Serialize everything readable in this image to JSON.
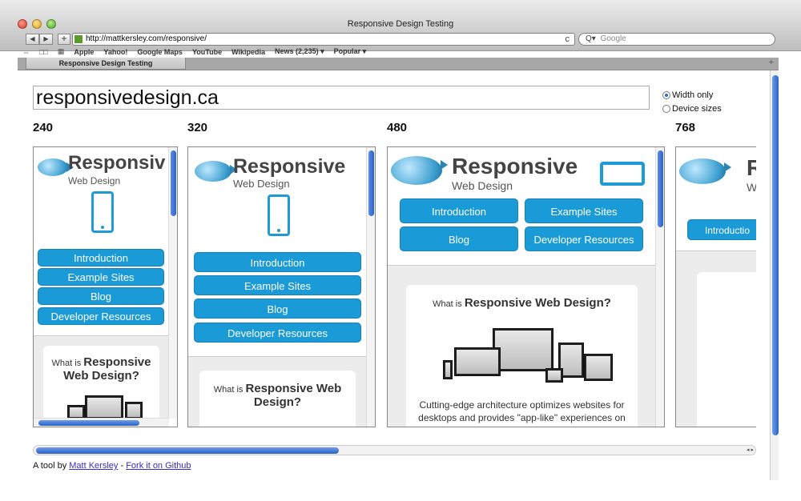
{
  "window": {
    "title": "Responsive Design Testing"
  },
  "toolbar": {
    "back_icon": "◀",
    "forward_icon": "▶",
    "add_icon": "+",
    "url": "http://mattkersley.com/responsive/",
    "reload_icon": "c",
    "search_icon": "Q▾",
    "search_placeholder": "Google"
  },
  "bookmarks": {
    "reader_icon": "⇔",
    "book_icon": "□□",
    "grid_icon": "▦",
    "items": [
      "Apple",
      "Yahoo!",
      "Google Maps",
      "YouTube",
      "Wikipedia",
      "News (2,235) ▾",
      "Popular ▾"
    ]
  },
  "tabs": [
    {
      "label": "Responsive Design Testing"
    }
  ],
  "tab_plus": "+",
  "page": {
    "url_input": "responsivedesign.ca",
    "options": [
      {
        "label": "Width only",
        "checked": true
      },
      {
        "label": "Device sizes",
        "checked": false
      }
    ],
    "widths": [
      "240",
      "320",
      "480",
      "768"
    ]
  },
  "site": {
    "logo_title_240": "Responsiv",
    "logo_title": "Responsive",
    "logo_title_768": "R",
    "logo_sub": "Web Design",
    "logo_sub_768": "W",
    "nav": [
      "Introduction",
      "Example Sites",
      "Blog",
      "Developer Resources"
    ],
    "nav_768": "Introductio",
    "question_pre": "What is",
    "question_bold": "Responsive Web Design?",
    "q240_b1": "Responsive",
    "q240_b2": "Web Design?",
    "q320_b1": "Responsive Web",
    "q320_b2": "Design?",
    "body_text": "Cutting-edge architecture optimizes websites for desktops and provides \"app-like\" experiences on smartphones, tablets and e-readers."
  },
  "footer": {
    "prefix": "A tool by",
    "author": "Matt Kersley",
    "sep": "-",
    "fork": "Fork it on Github"
  }
}
